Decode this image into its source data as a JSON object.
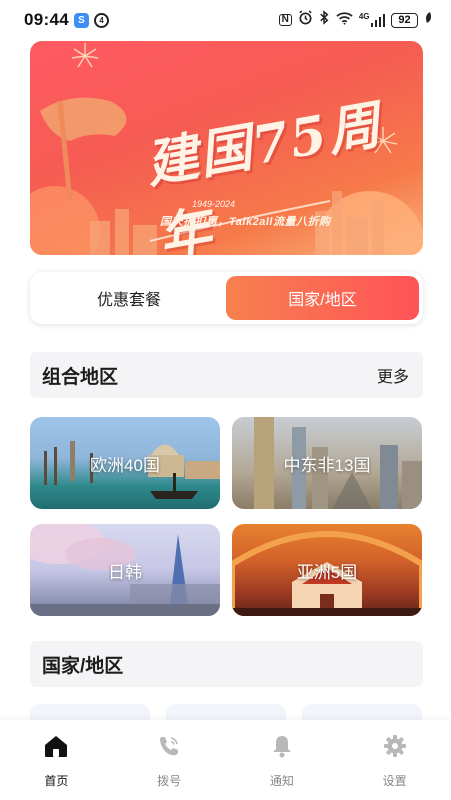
{
  "status_bar": {
    "time": "09:44",
    "app_icon_1": "app-blue-icon",
    "app_icon_2": "app-ring-icon",
    "icon_nfc": "N",
    "icons": [
      "nfc-icon",
      "alarm-icon",
      "bluetooth-icon",
      "wifi-icon",
      "signal-4g-icon",
      "battery-icon",
      "leaf-icon"
    ],
    "network": "4G",
    "battery": "92"
  },
  "banner": {
    "title": "建国75周年",
    "years": "1949-2024",
    "slogan": "国庆折扣惠，Talk2all流量八折购",
    "colors": {
      "start": "#ff5a63",
      "end": "#f9b27a"
    }
  },
  "tabs": [
    {
      "label": "优惠套餐",
      "active": false
    },
    {
      "label": "国家/地区",
      "active": true
    }
  ],
  "sections": {
    "combo": {
      "title": "组合地区",
      "more": "更多"
    },
    "countries": {
      "title": "国家/地区"
    }
  },
  "regions": [
    {
      "label": "欧洲40国",
      "icon": "venice-photo"
    },
    {
      "label": "中东非13国",
      "icon": "dubai-photo"
    },
    {
      "label": "日韩",
      "icon": "cherry-blossom-photo"
    },
    {
      "label": "亚洲5国",
      "icon": "thai-temple-photo"
    }
  ],
  "bottom_nav": [
    {
      "label": "首页",
      "icon": "home-icon",
      "active": true
    },
    {
      "label": "拨号",
      "icon": "phone-icon",
      "active": false
    },
    {
      "label": "通知",
      "icon": "bell-icon",
      "active": false
    },
    {
      "label": "设置",
      "icon": "gear-icon",
      "active": false
    }
  ],
  "accent_colors": {
    "primary_gradient_start": "#f7804f",
    "primary_gradient_end": "#ff5357",
    "nav_active": "#111111",
    "nav_inactive": "#888888"
  }
}
